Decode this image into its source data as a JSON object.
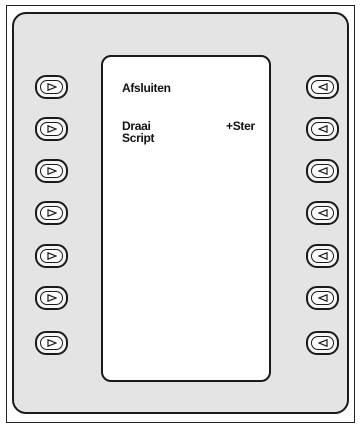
{
  "screen": {
    "line1_left": "Afsluiten",
    "line2_left": "Draai",
    "line2_right": "+Ster",
    "line3_left": "Script"
  },
  "softkeys": {
    "left_icon": "play-triangle-right-icon",
    "right_icon": "play-triangle-left-icon",
    "count_per_side": 7
  },
  "colors": {
    "panel_bg": "#e4e4e4",
    "screen_bg": "#ffffff",
    "stroke": "#1a1a1a"
  }
}
